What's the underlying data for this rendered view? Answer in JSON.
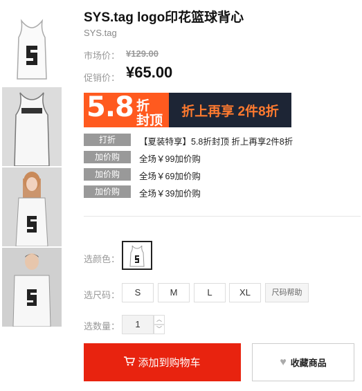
{
  "product": {
    "title": "SYS.tag logo印花篮球背心",
    "brand": "SYS.tag",
    "market_price_label": "市场价：",
    "market_price": "¥129.00",
    "promo_price_label": "促销价：",
    "promo_price": "¥65.00"
  },
  "banner": {
    "discount": "5.8",
    "zhe": "折",
    "fengding": "封顶",
    "right_text": "折上再享 2件8折"
  },
  "promotions": [
    {
      "tag": "打折",
      "text": "【夏装特享】5.8折封顶 折上再享2件8折"
    },
    {
      "tag": "加价购",
      "text": "全场￥99加价购"
    },
    {
      "tag": "加价购",
      "text": "全场￥69加价购"
    },
    {
      "tag": "加价购",
      "text": "全场￥39加价购"
    }
  ],
  "selectors": {
    "color_label": "选颜色：",
    "size_label": "选尺码：",
    "qty_label": "选数量：",
    "sizes": [
      "S",
      "M",
      "L",
      "XL"
    ],
    "size_help": "尺码帮助",
    "quantity": "1"
  },
  "actions": {
    "cart_icon": "shopping-cart-icon",
    "add_to_cart": "添加到购物车",
    "fav_icon": "heart-icon",
    "favorite": "收藏商品"
  },
  "colors": {
    "accent_red": "#e8230f",
    "banner_orange": "#ff5a1f",
    "banner_navy": "#1d2535"
  }
}
